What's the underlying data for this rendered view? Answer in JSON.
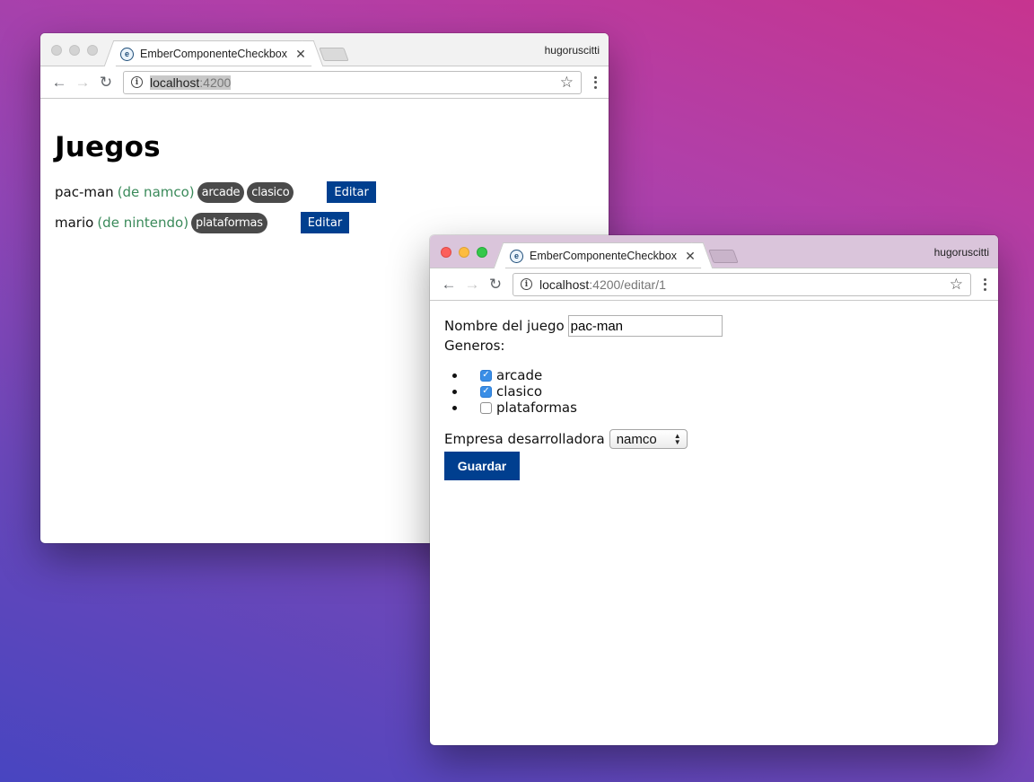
{
  "back_window": {
    "tab_title": "EmberComponenteCheckbox",
    "profile": "hugoruscitti",
    "url_host": "localhost",
    "url_rest": ":4200",
    "heading": "Juegos",
    "games": [
      {
        "name": "pac-man",
        "company": "(de namco)",
        "tags": [
          "arcade",
          "clasico"
        ],
        "edit_label": "Editar"
      },
      {
        "name": "mario",
        "company": "(de nintendo)",
        "tags": [
          "plataformas"
        ],
        "edit_label": "Editar"
      }
    ]
  },
  "front_window": {
    "tab_title": "EmberComponenteCheckbox",
    "profile": "hugoruscitti",
    "url_host": "localhost",
    "url_rest": ":4200/editar/1",
    "name_label": "Nombre del juego",
    "name_value": "pac-man",
    "genres_label": "Generos:",
    "genres": [
      {
        "label": "arcade",
        "checked": true
      },
      {
        "label": "clasico",
        "checked": true
      },
      {
        "label": "plataformas",
        "checked": false
      }
    ],
    "company_label": "Empresa desarrolladora",
    "company_selected": "namco",
    "save_label": "Guardar"
  },
  "colors": {
    "button_blue": "#003f8f",
    "badge_gray": "#4a4a4a",
    "company_green": "#3a8a5a",
    "checkbox_blue": "#3a8ee6"
  },
  "icons": {
    "tab_favicon": "ember-favicon-icon",
    "back": "arrow-left-icon",
    "forward": "arrow-right-icon",
    "reload": "reload-icon",
    "site_info": "info-icon",
    "bookmark": "star-icon",
    "menu": "kebab-menu-icon",
    "close_tab": "close-icon"
  }
}
